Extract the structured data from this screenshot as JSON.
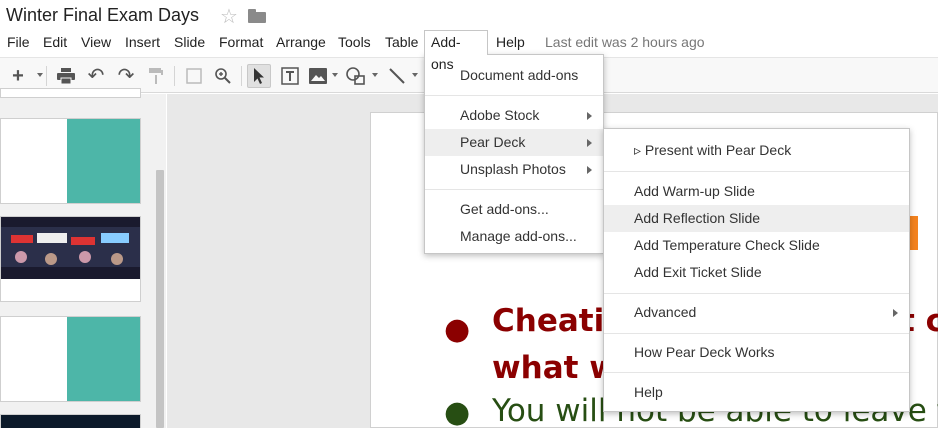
{
  "document": {
    "title": "Winter Final Exam Days",
    "star_icon": "☆"
  },
  "menubar": {
    "items": [
      "File",
      "Edit",
      "View",
      "Insert",
      "Slide",
      "Format",
      "Arrange",
      "Tools",
      "Table",
      "Add-ons",
      "Help"
    ],
    "last_edit": "Last edit was 2 hours ago"
  },
  "addons_menu": {
    "document_addons": "Document add-ons",
    "adobe_stock": "Adobe Stock",
    "pear_deck": "Pear Deck",
    "unsplash_photos": "Unsplash Photos",
    "get_addons": "Get add-ons...",
    "manage_addons": "Manage add-ons..."
  },
  "pear_deck_menu": {
    "present": "▹ Present with Pear Deck",
    "warmup": "Add Warm-up Slide",
    "reflection": "Add Reflection Slide",
    "temperature": "Add Temperature Check Slide",
    "exit_ticket": "Add Exit Ticket Slide",
    "advanced": "Advanced",
    "how_it_works": "How Pear Deck Works",
    "help": "Help"
  },
  "slide": {
    "line1_a": "Cheatin",
    "line1_b": "t c",
    "line2": "what w",
    "line3": "You will not be able to leave the"
  },
  "colors": {
    "accent_teal": "#4db6a8",
    "dark_red": "#8b0000",
    "dark_green": "#274e13",
    "orange": "#f4831f"
  }
}
